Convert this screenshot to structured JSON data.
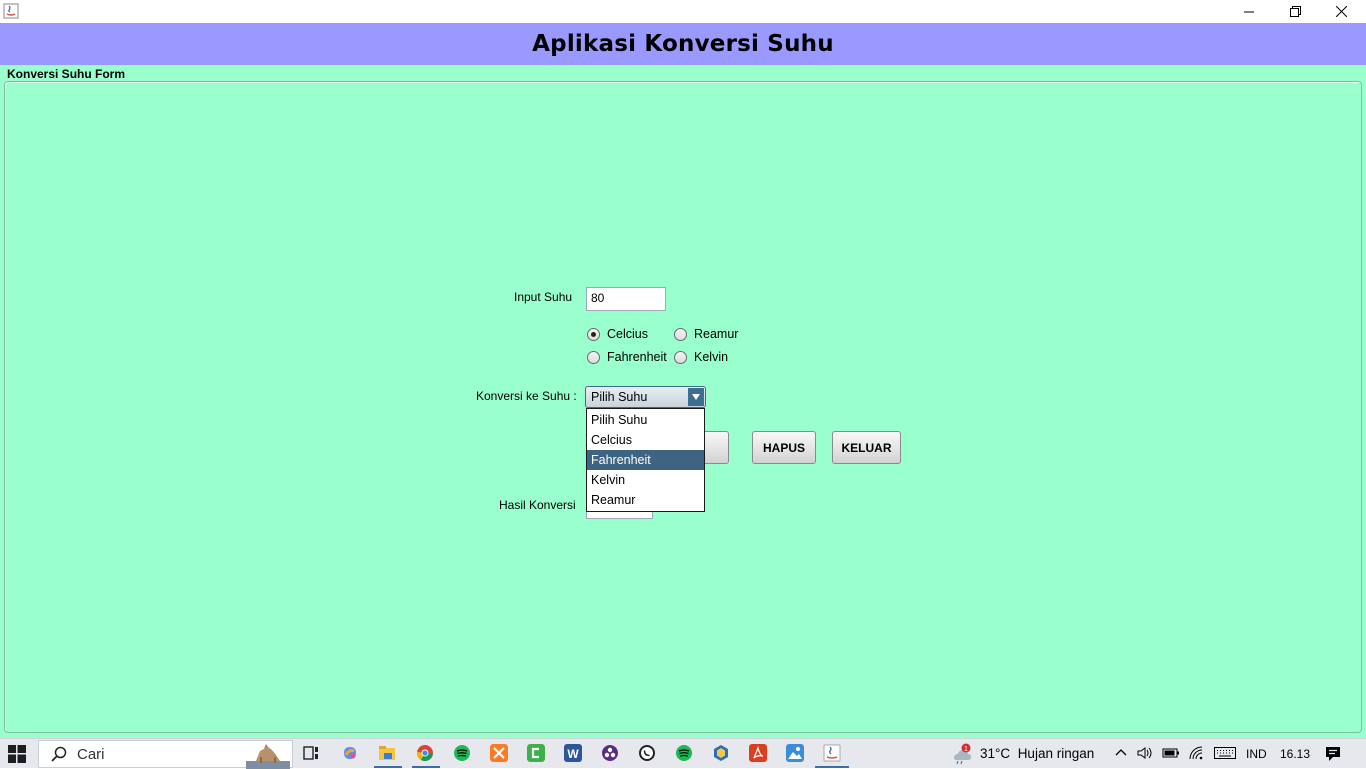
{
  "window": {
    "title": "Aplikasi Konversi Suhu",
    "controls": {
      "minimize": "—",
      "maximize": "❐",
      "close": "✕"
    }
  },
  "form": {
    "section_label": "Konversi Suhu Form",
    "input_label": "Input Suhu",
    "input_value": "80",
    "radios": [
      {
        "label": "Celcius",
        "checked": true
      },
      {
        "label": "Reamur",
        "checked": false
      },
      {
        "label": "Fahrenheit",
        "checked": false
      },
      {
        "label": "Kelvin",
        "checked": false
      }
    ],
    "convert_label": "Konversi ke Suhu :",
    "combo_selected": "Pilih Suhu",
    "dropdown_options": [
      "Pilih Suhu",
      "Celcius",
      "Fahrenheit",
      "Kelvin",
      "Reamur"
    ],
    "dropdown_highlighted_index": 2,
    "hapus_label": "HAPUS",
    "keluar_label": "KELUAR",
    "result_label": "Hasil Konversi",
    "result_value": ""
  },
  "taskbar": {
    "search_placeholder": "Cari",
    "temperature": "31°C",
    "weather": "Hujan ringan",
    "language": "IND",
    "time": "16.13",
    "weather_badge": "1"
  },
  "colors": {
    "header_bg": "#9999ff",
    "form_bg": "#99ffcc",
    "dropdown_highlight": "#3d6482"
  }
}
